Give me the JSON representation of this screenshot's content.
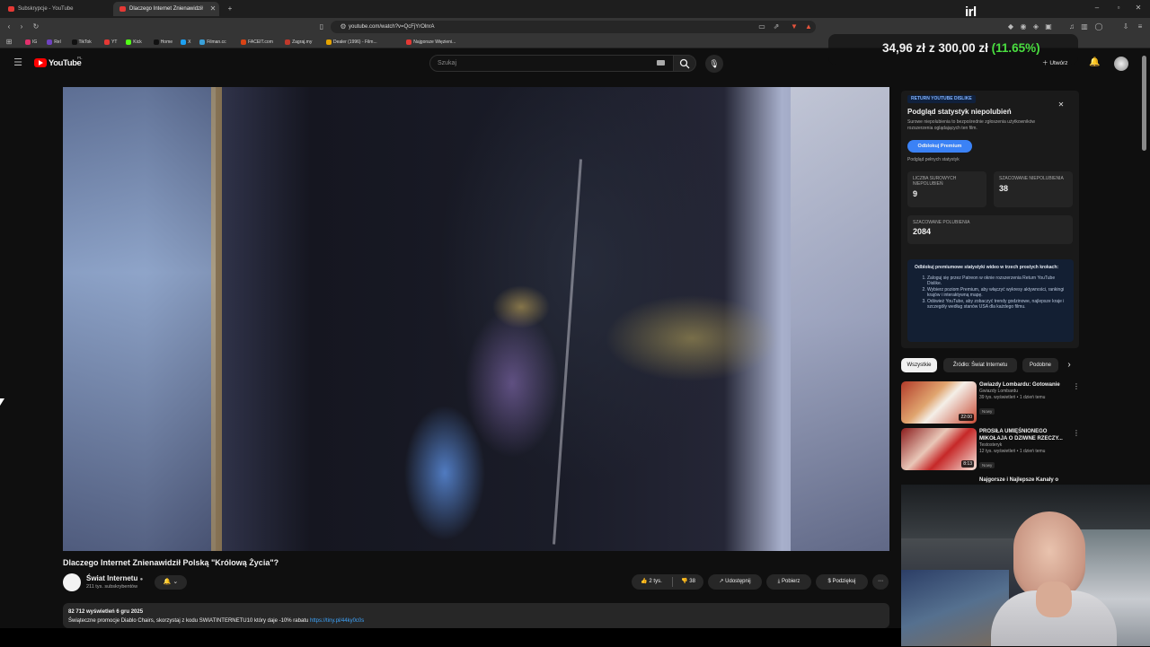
{
  "browser": {
    "tabs": [
      {
        "label": "Subskrypcje - YouTube",
        "active": false
      },
      {
        "label": "Dlaczego Internet Znienawidził",
        "active": true
      }
    ],
    "url": "youtube.com/watch?v=QcFjYrOlnrA",
    "bookmarks": [
      "IG",
      "Rel",
      "TikTok",
      "YT",
      "Kick",
      "Home",
      "X",
      "Filman.cc",
      "FACEIT.com",
      "Zagraj.my",
      "Dealer (1996) - Film...",
      "Najgorsze Więzieni..."
    ],
    "bookmark_colors": [
      "#e1306c",
      "#6f42c1",
      "#111111",
      "#e53935",
      "#53fc18",
      "#111111",
      "#1da1f2",
      "#3aa0d8",
      "#d84315",
      "#c0392b",
      "#e6a400",
      "#e53935"
    ]
  },
  "youtube": {
    "logo": "YouTube",
    "logo_region": "PL",
    "search_placeholder": "Szukaj",
    "create_label": "Utwórz"
  },
  "overlay": {
    "donation": "34,96 zł",
    "donation_of": "z",
    "donation_goal": "300,00 zł",
    "donation_pct": "(11.65%)",
    "brand": "irl"
  },
  "video": {
    "title": "Dlaczego Internet Znienawidził Polską \"Królową Życia\"?",
    "channel": "Świat Internetu",
    "subscribers": "211 tys. subskrybentów",
    "likes": "2 tys.",
    "dislikes": "38",
    "share_label": "Udostępnij",
    "download_label": "Pobierz",
    "thanks_label": "Podziękuj",
    "views_date": "82 712 wyświetleń  6 gru 2025",
    "description": "Świąteczne promocje Diablo Chairs, skorzystaj z kodu SWIATINTERNETU10 który daje -10% rabatu",
    "description_link": "https://tiny.pl/44ky0c0s"
  },
  "ryd": {
    "badge": "RETURN YOUTUBE DISLIKE",
    "title": "Podgląd statystyk niepolubień",
    "subtitle": "Surowe niepolubienia to bezpośrednie zgłoszenia użytkowników rozszerzenia oglądających ten film.",
    "unlock_button": "Odblokuj Premium",
    "full_stats": "Podgląd pełnych statystyk",
    "raw_label": "LICZBA SUROWYCH NIEPOLUBIEŃ",
    "raw_value": "9",
    "est_label": "SZACOWANE NIEPOLUBIENIA",
    "est_value": "38",
    "likes_label": "SZACOWANE POLUBIENIA",
    "likes_value": "2084",
    "promo_title": "Odblokuj premiumowe statystyki wideo w trzech prostych krokach:",
    "promo_steps": [
      "Zaloguj się przez Patreon w oknie rozszerzenia Return YouTube Dislike.",
      "Wybierz poziom Premium, aby włączyć wykresy aktywności, rankingi krajów i interaktywną mapę.",
      "Odśwież YouTube, aby zobaczyć trendy godzinowe, najlepsze kraje i szczegóły według stanów USA dla każdego filmu."
    ]
  },
  "chips": [
    "Wszystkie",
    "Źródło: Świat Internetu",
    "Podobne"
  ],
  "recommendations": [
    {
      "title": "Gwiazdy Lombardu: Gotowanie",
      "channel": "Gwiazdy Lombardu",
      "meta": "39 tys. wyświetleń • 1 dzień temu",
      "badge": "Nowy",
      "duration": "22:00"
    },
    {
      "title": "PROSIŁA UMIĘŚNIONEGO MIKOŁAJA O DZIWNE RZECZY...",
      "channel": "Testosteryk",
      "meta": "12 tys. wyświetleń • 1 dzień temu",
      "badge": "Nowy",
      "duration": "8:13"
    },
    {
      "title": "Najgorsze i Najlepsze Kanały o",
      "channel": "",
      "meta": "",
      "badge": "",
      "duration": ""
    }
  ]
}
